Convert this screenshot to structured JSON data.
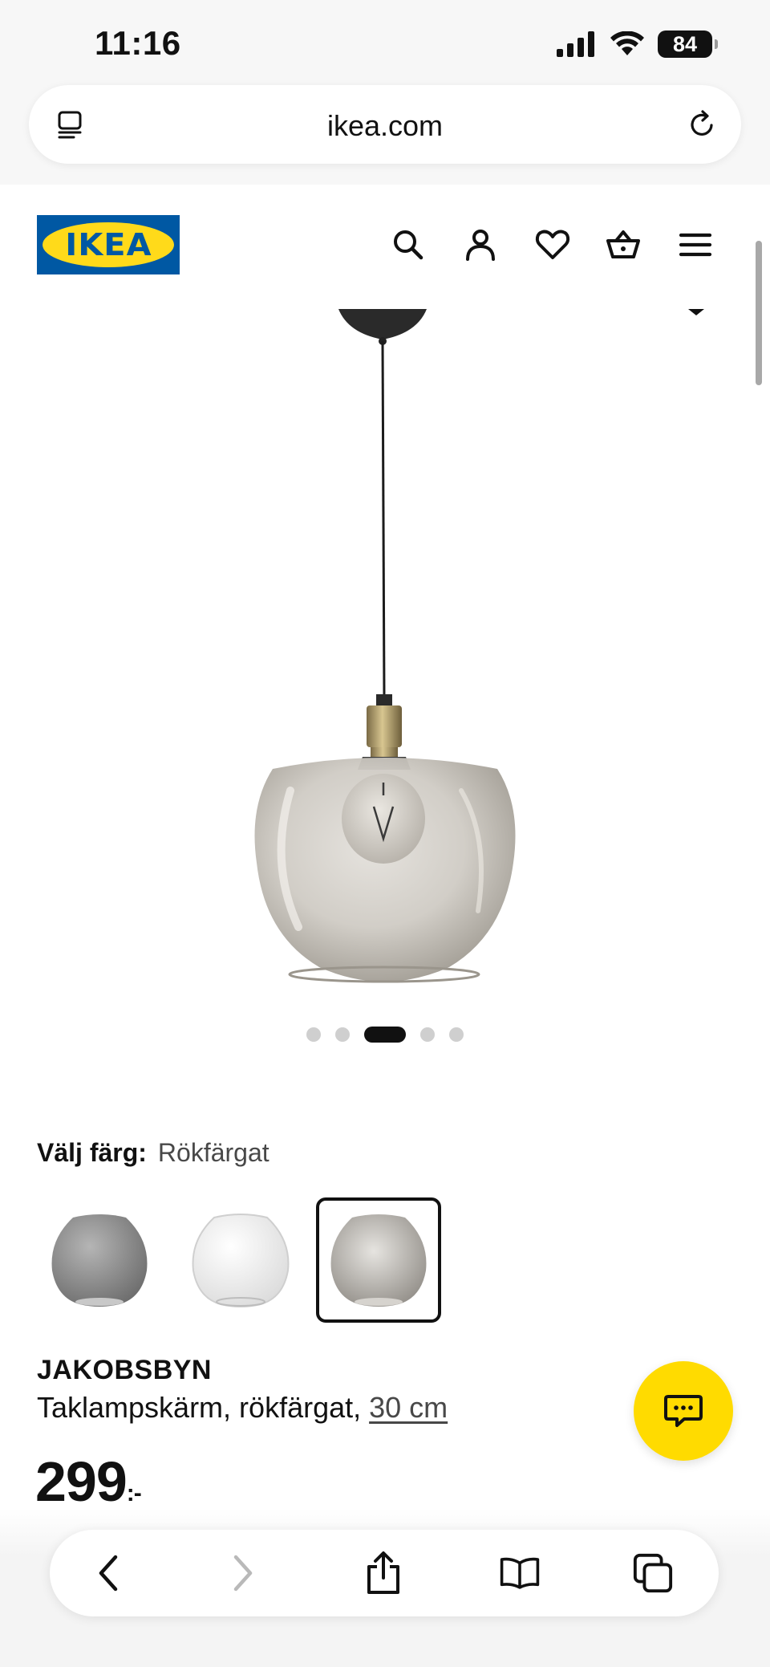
{
  "status_bar": {
    "time": "11:16",
    "battery": "84",
    "icons": [
      "cellular-signal-icon",
      "wifi-icon",
      "battery-icon"
    ]
  },
  "browser": {
    "url": "ikea.com",
    "icons": [
      "reader-mode-icon",
      "reload-icon"
    ]
  },
  "header": {
    "logo_text": "IKEA",
    "icons": [
      "search-icon",
      "account-icon",
      "heart-icon",
      "basket-icon",
      "menu-icon"
    ],
    "colors": {
      "logo_blue": "#0058a3",
      "logo_yellow": "#ffda1a"
    }
  },
  "gallery": {
    "image": "smoke-glass-pendant-lamp",
    "slide_count": 5,
    "active_slide": 3
  },
  "colour": {
    "label": "Välj färg:",
    "value": "Rökfärgat",
    "options": [
      {
        "name": "grey-glass-shade",
        "color": "#8c8c8c",
        "selected": false
      },
      {
        "name": "clear-glass-shade",
        "color": "#f2f2f2",
        "selected": false
      },
      {
        "name": "smoke-glass-shade",
        "color": "#b9b6b1",
        "selected": true
      }
    ]
  },
  "product": {
    "name": "JAKOBSBYN",
    "description": "Taklampskärm, rökfärgat, ",
    "size": "30 cm",
    "price": "299",
    "price_suffix": ":-"
  },
  "chat": {
    "icon": "chat-icon",
    "color": "#ffdb00"
  },
  "toolbar": {
    "icons": [
      "back-icon",
      "forward-icon",
      "share-icon",
      "bookmarks-icon",
      "tabs-icon"
    ]
  }
}
